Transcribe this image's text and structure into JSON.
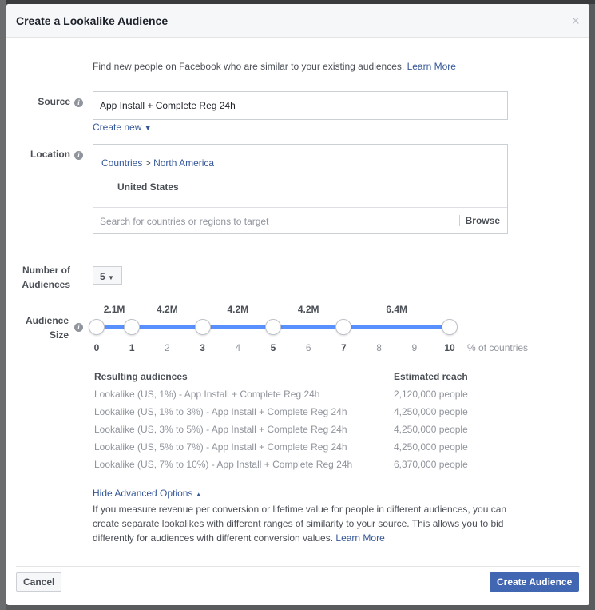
{
  "title": "Create a Lookalike Audience",
  "intro": "Find new people on Facebook who are similar to your existing audiences.",
  "learn_more": "Learn More",
  "source": {
    "label": "Source",
    "value": "App Install + Complete Reg 24h",
    "create_new": "Create new"
  },
  "location": {
    "label": "Location",
    "breadcrumb_1": "Countries",
    "sep": ">",
    "breadcrumb_2": "North America",
    "selected": "United States",
    "search_placeholder": "Search for countries or regions to target",
    "browse": "Browse"
  },
  "num_audiences": {
    "label_1": "Number of",
    "label_2": "Audiences",
    "value": "5"
  },
  "audience_size": {
    "label_1": "Audience",
    "label_2": "Size",
    "ticks": [
      "0",
      "1",
      "2",
      "3",
      "4",
      "5",
      "6",
      "7",
      "8",
      "9",
      "10"
    ],
    "handles": [
      0,
      1,
      3,
      5,
      7,
      10
    ],
    "segments": [
      "2.1M",
      "4.2M",
      "4.2M",
      "4.2M",
      "6.4M"
    ],
    "unit": "% of countries",
    "accent": "#5890ff"
  },
  "results": {
    "col1": "Resulting audiences",
    "col2": "Estimated reach",
    "rows": [
      {
        "name": "Lookalike (US, 1%) - App Install + Complete Reg 24h",
        "reach": "2,120,000 people"
      },
      {
        "name": "Lookalike (US, 1% to 3%) - App Install + Complete Reg 24h",
        "reach": "4,250,000 people"
      },
      {
        "name": "Lookalike (US, 3% to 5%) - App Install + Complete Reg 24h",
        "reach": "4,250,000 people"
      },
      {
        "name": "Lookalike (US, 5% to 7%) - App Install + Complete Reg 24h",
        "reach": "4,250,000 people"
      },
      {
        "name": "Lookalike (US, 7% to 10%) - App Install + Complete Reg 24h",
        "reach": "6,370,000 people"
      }
    ]
  },
  "advanced": {
    "toggle": "Hide Advanced Options",
    "text": "If you measure revenue per conversion or lifetime value for people in different audiences, you can create separate lookalikes with different ranges of similarity to your source. This allows you to bid differently for audiences with different conversion values.",
    "learn_more": "Learn More"
  },
  "footer": {
    "cancel": "Cancel",
    "create": "Create Audience"
  }
}
